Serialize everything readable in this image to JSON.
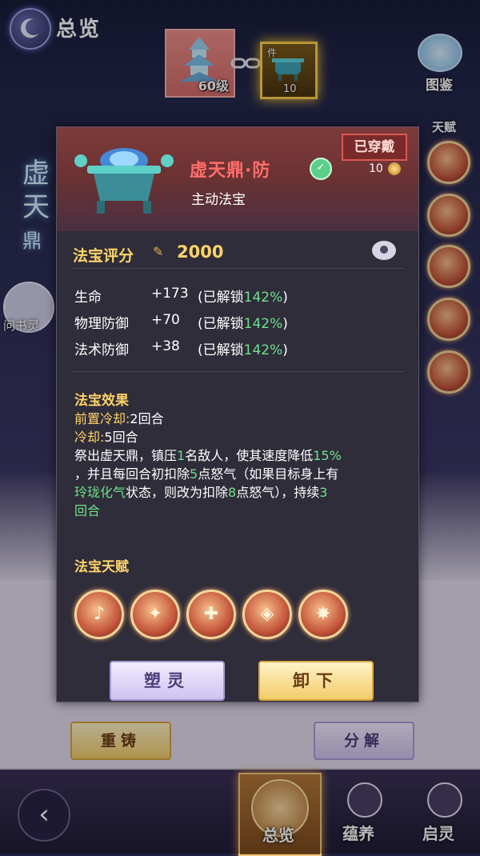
{
  "header": {
    "title": "总览",
    "equipped_level": "60级",
    "item_level": "10",
    "item_tag": "件",
    "codex_label": "图鉴"
  },
  "side": {
    "vertical_name_1": "虚",
    "vertical_name_2": "天",
    "vertical_name_3": "鼎",
    "spirit_label": "问书灵",
    "talent_label": "天赋"
  },
  "popup": {
    "name": "虚天鼎·防",
    "type": "主动法宝",
    "status": "已穿戴",
    "level": "10",
    "score_label": "法宝评分",
    "score_value": "2000",
    "stats": [
      {
        "name": "生命",
        "value": "+173",
        "lock_prefix": "(已解锁",
        "lock_pct": "142%",
        "lock_suffix": ")"
      },
      {
        "name": "物理防御",
        "value": "+70",
        "lock_prefix": "(已解锁",
        "lock_pct": "142%",
        "lock_suffix": ")"
      },
      {
        "name": "法术防御",
        "value": "+38",
        "lock_prefix": "(已解锁",
        "lock_pct": "142%",
        "lock_suffix": ")"
      }
    ],
    "effect": {
      "title": "法宝效果",
      "pre_cd_label": "前置冷却:",
      "pre_cd_value": "2回合",
      "cd_label": "冷却:",
      "cd_value": "5回合",
      "desc_1a": "祭出虚天鼎，镇压",
      "desc_1b": "1",
      "desc_1c": "名敌人，使其速度降低",
      "desc_1d": "15%",
      "desc_2a": "，并且每回合初扣除",
      "desc_2b": "5",
      "desc_2c": "点怒气（如果目标身上有",
      "desc_3a": "玲珑化气",
      "desc_3b": "状态，则改为扣除",
      "desc_3c": "8",
      "desc_3d": "点怒气），持续",
      "desc_3e": "3",
      "desc_4": "回合"
    },
    "talent_title": "法宝天赋",
    "mold_button": "塑灵",
    "unequip_button": "卸下"
  },
  "background": {
    "recast_button": "重铸",
    "split_button": "分解"
  },
  "nav": {
    "overview": "总览",
    "nurture": "蕴养",
    "awaken": "启灵"
  },
  "colors": {
    "name_red": "#ff6f6a",
    "gold": "#ffd46a",
    "green": "#6fe08c"
  }
}
